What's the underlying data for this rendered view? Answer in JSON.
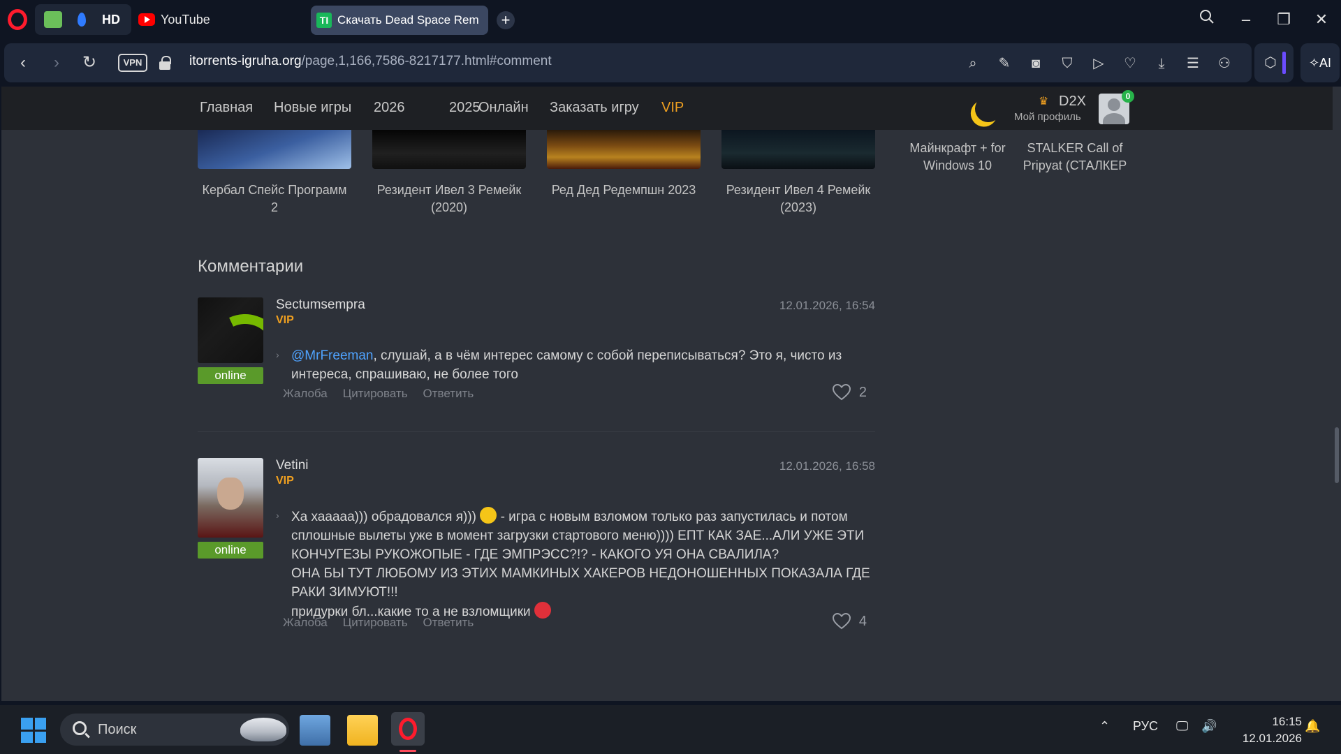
{
  "browser": {
    "tabs": {
      "pinned_hd_label": "HD",
      "youtube_label": "YouTube",
      "active_tab_title": "Скачать Dead Space Rem",
      "active_tab_favicon": "TI"
    },
    "address": {
      "vpn_label": "VPN",
      "host": "itorrents-igruha.org",
      "path": "/page,1,166,7586-8217177.html#comment"
    },
    "ai_label": "AI"
  },
  "site": {
    "nav": [
      "Главная",
      "Новые игры",
      "2026",
      "2025",
      "Онлайн",
      "Заказать игру",
      "VIP"
    ],
    "user": {
      "name": "D2X",
      "profile_label": "Мой профиль",
      "notifications": "0"
    },
    "related_games": [
      "Кербал Спейс Программ 2",
      "Резидент Ивел 3 Ремейк (2020)",
      "Ред Дед Редемпшн 2023",
      "Резидент Ивел 4 Ремейк (2023)"
    ],
    "sidebar_games": [
      "Майнкрафт + for Windows 10",
      "STALKER Call of Pripyat (СТАЛКЕР"
    ],
    "comments_title": "Комментарии",
    "comments": [
      {
        "author": "Sectumsempra",
        "rank": "VIP",
        "status": "online",
        "date": "12.01.2026, 16:54",
        "mention": "@MrFreeman",
        "text": ", слушай, а в чём интерес самому с собой переписываться? Это я, чисто из интереса, спрашиваю, не более того",
        "likes": "2"
      },
      {
        "author": "Vetini",
        "rank": "VIP",
        "status": "online",
        "date": "12.01.2026, 16:58",
        "text_part1": "Ха хааааа))) обрадовался я)))",
        "text_part2": " - игра с новым взломом только раз запустилась и потом сплошные вылеты уже в момент загрузки стартового меню)))) ЕПТ КАК ЗАЕ...АЛИ УЖЕ ЭТИ КОНЧУГЕЗЫ РУКОЖОПЫЕ - ГДЕ ЭМПРЭСС?!? - КАКОГО УЯ ОНА СВАЛИЛА?",
        "text_part3": "ОНА БЫ ТУТ ЛЮБОМУ ИЗ ЭТИХ МАМКИНЫХ ХАКЕРОВ НЕДОНОШЕННЫХ ПОКАЗАЛА ГДЕ РАКИ ЗИМУЮТ!!!",
        "text_part4": "придурки бл...какие то а не взломщики",
        "likes": "4"
      }
    ],
    "actions": {
      "report": "Жалоба",
      "quote": "Цитировать",
      "reply": "Ответить"
    }
  },
  "taskbar": {
    "search_placeholder": "Поиск",
    "language": "РУС",
    "time": "16:15",
    "date": "12.01.2026"
  },
  "colors": {
    "accent_vip": "#f0a020",
    "online_badge": "#5a9a2a",
    "mention": "#4fa3ff",
    "opera_red": "#ff1b2d"
  }
}
